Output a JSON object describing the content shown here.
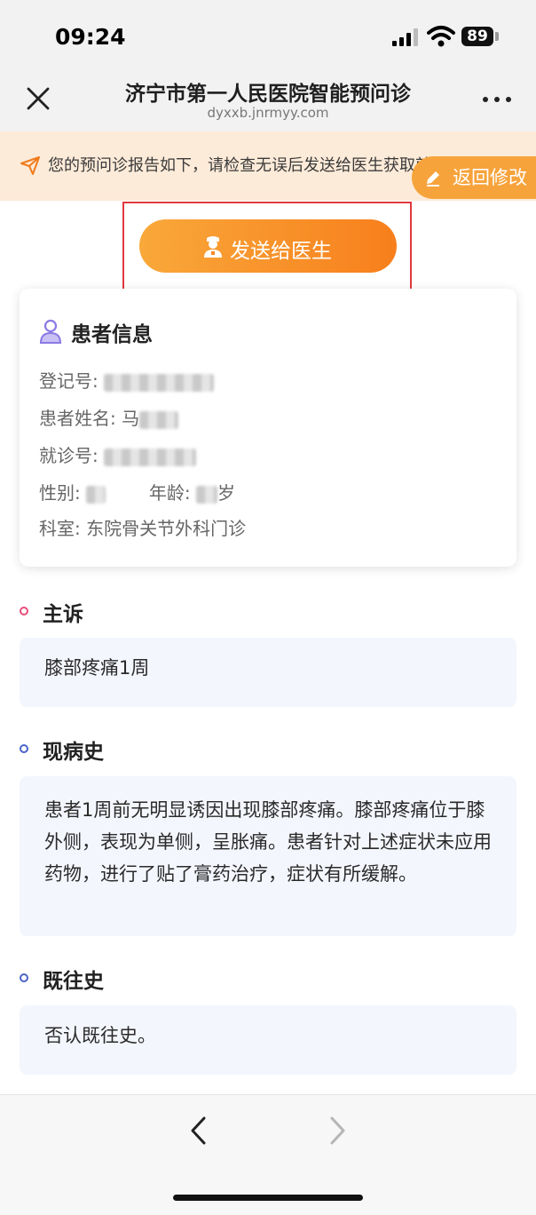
{
  "status_bar": {
    "time": "09:24",
    "battery": "89"
  },
  "nav": {
    "title": "济宁市第一人民医院智能预问诊",
    "url": "dyxxb.jnrmyy.com"
  },
  "notice": {
    "text": "您的预问诊报告如下，请检查无误后发送给医生获取就诊指导",
    "return_label": "返回修改"
  },
  "actions": {
    "send_label": "发送给医生"
  },
  "patient": {
    "title": "患者信息",
    "reg_label": "登记号:",
    "name_label": "患者姓名:",
    "name_value": "马",
    "visit_label": "就诊号:",
    "gender_label": "性别:",
    "age_label": "年龄:",
    "age_unit": "岁",
    "dept_label": "科室:",
    "dept_value": "东院骨关节外科门诊"
  },
  "sections": [
    {
      "title": "主诉",
      "content": "膝部疼痛1周"
    },
    {
      "title": "现病史",
      "content": "患者1周前无明显诱因出现膝部疼痛。膝部疼痛位于膝外侧，表现为单侧，呈胀痛。患者针对上述症状未应用药物，进行了贴了膏药治疗，症状有所缓解。"
    },
    {
      "title": "既往史",
      "content": "否认既往史。"
    }
  ],
  "colors": {
    "accent": "#f77f1c",
    "notice_bg": "#fdebd9",
    "section_bg": "#f4f6fe",
    "highlight": "#e0393e"
  }
}
